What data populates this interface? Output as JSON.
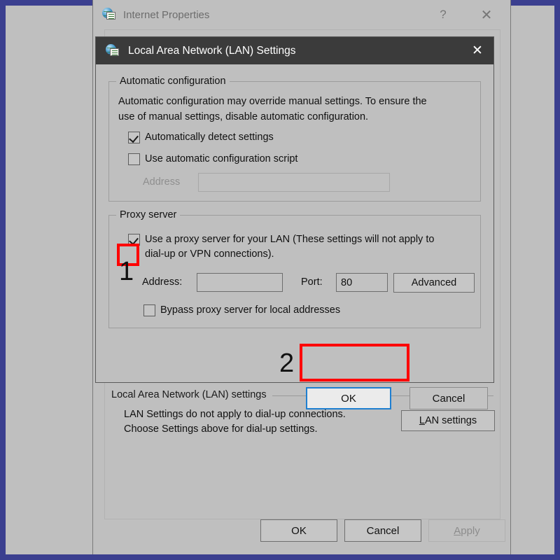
{
  "frame": {
    "border_color": "#3b3f8f",
    "backdrop_color": "#bfbfbf"
  },
  "internet_properties": {
    "title": "Internet Properties",
    "icon": "internet-properties-icon",
    "help_label": "?",
    "close_label": "✕",
    "lan_group": {
      "label": "Local Area Network (LAN) settings",
      "description_line1": "LAN Settings do not apply to dial-up connections.",
      "description_line2": "Choose Settings above for dial-up settings.",
      "button_accel": "L",
      "button_rest": "AN settings"
    },
    "footer": {
      "ok_label": "OK",
      "cancel_label": "Cancel",
      "apply_accel": "A",
      "apply_rest": "pply",
      "apply_disabled": true
    }
  },
  "lan_dialog": {
    "title": "Local Area Network (LAN) Settings",
    "icon": "internet-properties-icon",
    "close_label": "✕",
    "automatic_configuration": {
      "group_label": "Automatic configuration",
      "description_line1": "Automatic configuration may override manual settings.  To ensure the",
      "description_line2": "use of manual settings, disable automatic configuration.",
      "auto_detect": {
        "label": "Automatically detect settings",
        "checked": true
      },
      "use_script": {
        "label": "Use automatic configuration script",
        "checked": false
      },
      "address_label": "Address",
      "address_value": "",
      "address_disabled": true
    },
    "proxy_server": {
      "group_label": "Proxy server",
      "use_proxy": {
        "label": "Use a proxy server for your LAN (These settings will not apply to dial-up or VPN connections).",
        "checked": true
      },
      "address_label": "Address:",
      "address_value": "",
      "port_label": "Port:",
      "port_value": "80",
      "advanced_label": "Advanced",
      "bypass": {
        "label": "Bypass proxy server for local addresses",
        "checked": false
      }
    },
    "footer": {
      "ok_label": "OK",
      "cancel_label": "Cancel",
      "ok_focused": true
    }
  },
  "annotations": {
    "color": "#ff0000",
    "markers": [
      {
        "number": "1",
        "target": "use-a-proxy-server-checkbox"
      },
      {
        "number": "2",
        "target": "lan-dialog-ok-button"
      }
    ]
  }
}
